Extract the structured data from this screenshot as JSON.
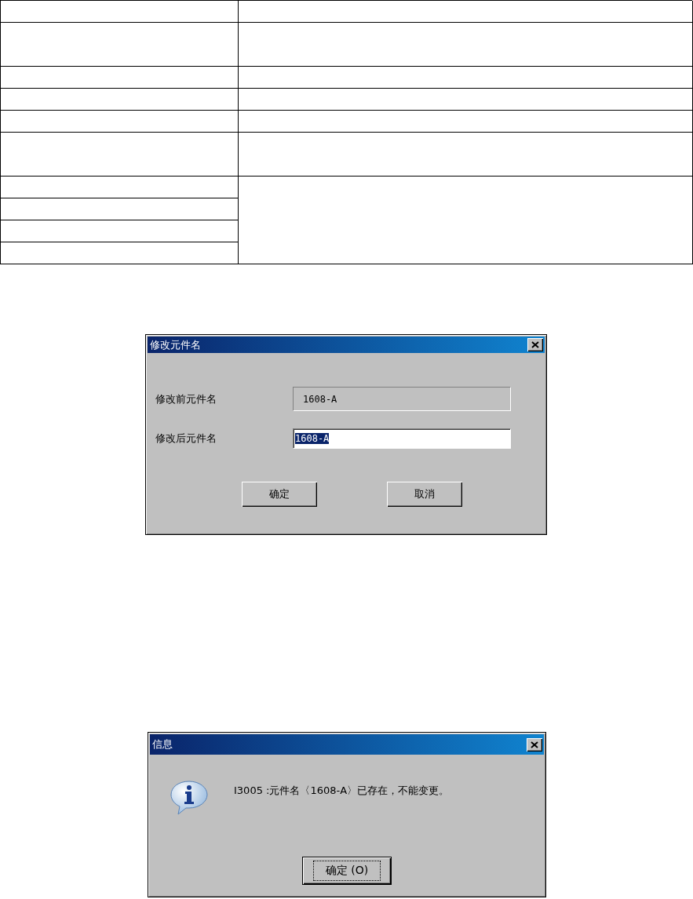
{
  "rename_dialog": {
    "title": "修改元件名",
    "fields": [
      {
        "label": "修改前元件名",
        "value": "1608-A",
        "disabled": true,
        "selected": false
      },
      {
        "label": "修改后元件名",
        "value": "1608-A",
        "disabled": false,
        "selected": true
      }
    ],
    "buttons": [
      "确定",
      "取消"
    ]
  },
  "info_dialog": {
    "title": "信息",
    "message": "I3005 :元件名〈1608-A〉已存在，不能变更。",
    "button": {
      "label": "确定 (O)",
      "focused": true
    }
  }
}
